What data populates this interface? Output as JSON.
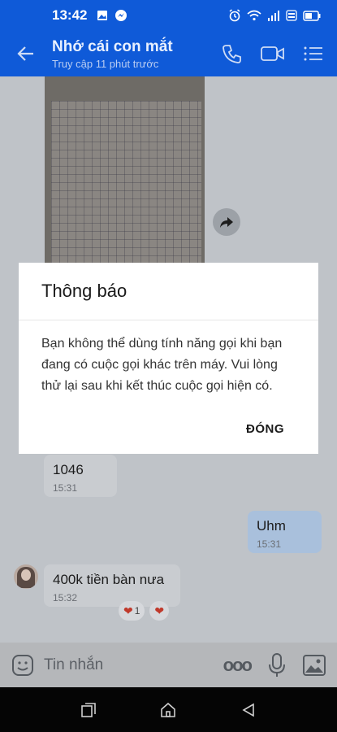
{
  "status_bar": {
    "time": "13:42"
  },
  "header": {
    "contact_name": "Nhớ cái con mắt",
    "last_seen": "Truy cập 11 phút trước"
  },
  "messages": [
    {
      "text": "1046",
      "time": "15:31"
    },
    {
      "text": "Uhm",
      "time": "15:31"
    },
    {
      "text": "400k tiền bàn nưa",
      "time": "15:32"
    }
  ],
  "reactions": [
    {
      "count": "1"
    },
    {
      "count": ""
    }
  ],
  "input": {
    "placeholder": "Tin nhắn",
    "more": "ooo"
  },
  "dialog": {
    "title": "Thông báo",
    "message": "Bạn không thể dùng tính năng gọi khi bạn đang có cuộc gọi khác trên máy. Vui lòng thử lại sau khi kết thúc cuộc gọi hiện có.",
    "close_label": "ĐÓNG"
  }
}
